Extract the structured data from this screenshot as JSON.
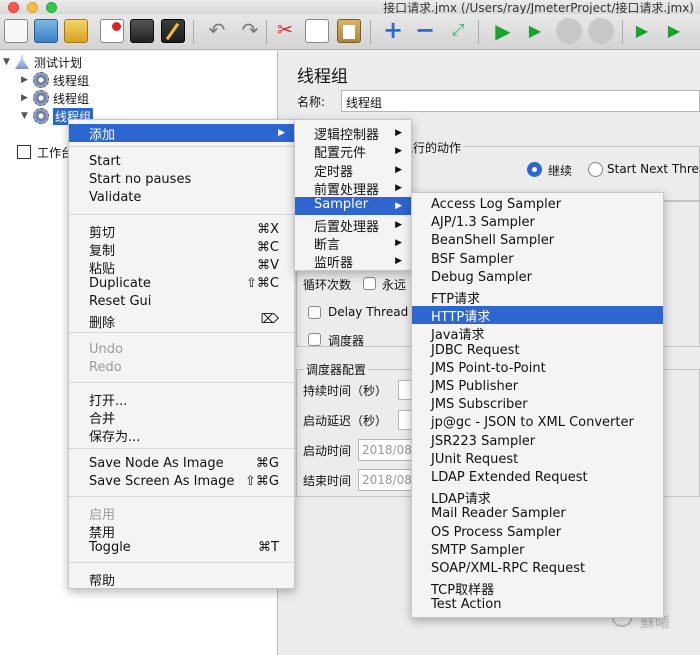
{
  "window": {
    "title": "接口请求.jmx (/Users/ray/JmeterProject/接口请求.jmx)"
  },
  "tree": {
    "items": [
      {
        "label": "测试计划",
        "expanded": true
      },
      {
        "label": "线程组"
      },
      {
        "label": "线程组"
      },
      {
        "label": "线程组",
        "selected": true
      },
      {
        "label": "工作台"
      }
    ]
  },
  "panel": {
    "title": "线程组",
    "name_label": "名称:",
    "name_value": "线程组",
    "action_group_label": "执行的动作",
    "radio_continue": "继续",
    "radio_next": "Start Next Threa",
    "loop_label": "循环次数",
    "forever_label": "永远",
    "delay_label": "Delay Thread",
    "scheduler_label": "调度器",
    "scheduler_config_label": "调度器配置",
    "duration_label": "持续时间（秒）",
    "startup_delay_label": "启动延迟（秒）",
    "start_time_label": "启动时间",
    "start_time_value": "2018/08",
    "end_time_label": "结束时间",
    "end_time_value": "2018/08"
  },
  "context_menu": {
    "add_label": "添加",
    "items": [
      {
        "label": "Start",
        "shortcut": ""
      },
      {
        "label": "Start no pauses",
        "shortcut": ""
      },
      {
        "label": "Validate",
        "shortcut": ""
      },
      {
        "label": "剪切",
        "shortcut": "⌘X"
      },
      {
        "label": "复制",
        "shortcut": "⌘C"
      },
      {
        "label": "粘贴",
        "shortcut": "⌘V"
      },
      {
        "label": "Duplicate",
        "shortcut": "⇧⌘C"
      },
      {
        "label": "Reset Gui",
        "shortcut": ""
      },
      {
        "label": "删除",
        "shortcut": "⌦"
      },
      {
        "label": "Undo",
        "shortcut": "",
        "disabled": true
      },
      {
        "label": "Redo",
        "shortcut": "",
        "disabled": true
      },
      {
        "label": "打开...",
        "shortcut": ""
      },
      {
        "label": "合并",
        "shortcut": ""
      },
      {
        "label": "保存为...",
        "shortcut": ""
      },
      {
        "label": "Save Node As Image",
        "shortcut": "⌘G"
      },
      {
        "label": "Save Screen As Image",
        "shortcut": "⇧⌘G"
      },
      {
        "label": "启用",
        "shortcut": "",
        "disabled": true
      },
      {
        "label": "禁用",
        "shortcut": ""
      },
      {
        "label": "Toggle",
        "shortcut": "⌘T"
      },
      {
        "label": "帮助",
        "shortcut": ""
      }
    ]
  },
  "add_submenu": {
    "items": [
      {
        "label": "逻辑控制器"
      },
      {
        "label": "配置元件"
      },
      {
        "label": "定时器"
      },
      {
        "label": "前置处理器"
      },
      {
        "label": "Sampler",
        "highlighted": true
      },
      {
        "label": "后置处理器"
      },
      {
        "label": "断言"
      },
      {
        "label": "监听器"
      }
    ]
  },
  "sampler_submenu": {
    "items": [
      {
        "label": "Access Log Sampler"
      },
      {
        "label": "AJP/1.3 Sampler"
      },
      {
        "label": "BeanShell Sampler"
      },
      {
        "label": "BSF Sampler"
      },
      {
        "label": "Debug Sampler"
      },
      {
        "label": "FTP请求"
      },
      {
        "label": "HTTP请求",
        "highlighted": true
      },
      {
        "label": "Java请求"
      },
      {
        "label": "JDBC Request"
      },
      {
        "label": "JMS Point-to-Point"
      },
      {
        "label": "JMS Publisher"
      },
      {
        "label": "JMS Subscriber"
      },
      {
        "label": "jp@gc - JSON to XML Converter"
      },
      {
        "label": "JSR223 Sampler"
      },
      {
        "label": "JUnit Request"
      },
      {
        "label": "LDAP Extended Request"
      },
      {
        "label": "LDAP请求"
      },
      {
        "label": "Mail Reader Sampler"
      },
      {
        "label": "OS Process Sampler"
      },
      {
        "label": "SMTP Sampler"
      },
      {
        "label": "SOAP/XML-RPC Request"
      },
      {
        "label": "TCP取样器"
      },
      {
        "label": "Test Action"
      }
    ]
  },
  "watermark": {
    "text": "蘇曦"
  }
}
